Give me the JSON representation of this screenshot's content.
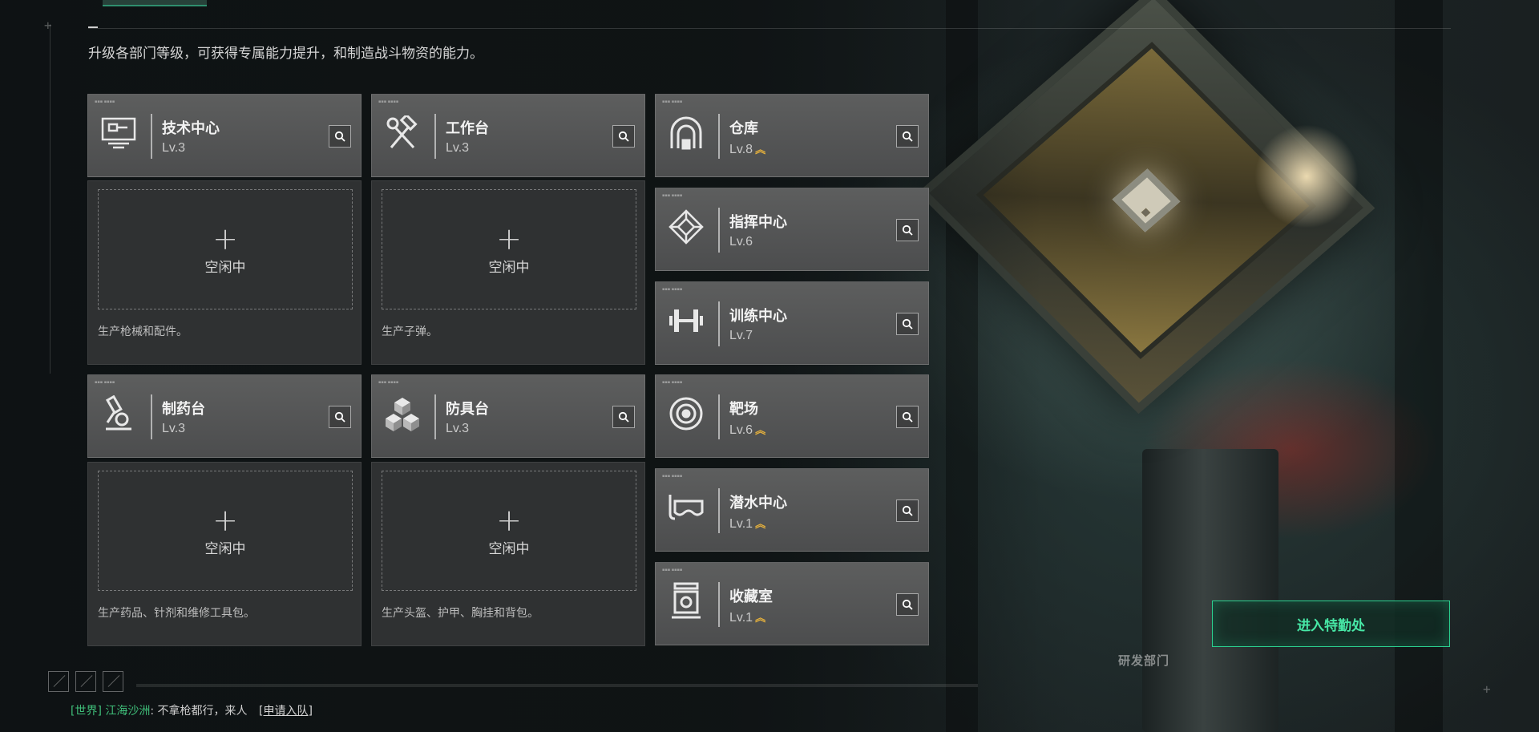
{
  "header": {
    "subtitle": "升级各部门等级，可获得专属能力提升，和制造战斗物资的能力。"
  },
  "production": [
    {
      "name": "技术中心",
      "level": "Lv.3",
      "icon": "computer-terminal-icon",
      "slot_status": "空闲中",
      "slot_plus": "+",
      "description": "生产枪械和配件。"
    },
    {
      "name": "工作台",
      "level": "Lv.3",
      "icon": "hammer-wrench-icon",
      "slot_status": "空闲中",
      "slot_plus": "+",
      "description": "生产子弹。"
    },
    {
      "name": "制药台",
      "level": "Lv.3",
      "icon": "microscope-icon",
      "slot_status": "空闲中",
      "slot_plus": "+",
      "description": "生产药品、针剂和维修工具包。"
    },
    {
      "name": "防具台",
      "level": "Lv.3",
      "icon": "cubes-icon",
      "slot_status": "空闲中",
      "slot_plus": "+",
      "description": "生产头盔、护甲、胸挂和背包。"
    }
  ],
  "facilities": [
    {
      "name": "仓库",
      "level": "Lv.8",
      "upgradable": true,
      "icon": "warehouse-icon"
    },
    {
      "name": "指挥中心",
      "level": "Lv.6",
      "upgradable": false,
      "icon": "chip-icon"
    },
    {
      "name": "训练中心",
      "level": "Lv.7",
      "upgradable": false,
      "icon": "dumbbell-icon"
    },
    {
      "name": "靶场",
      "level": "Lv.6",
      "upgradable": true,
      "icon": "target-icon"
    },
    {
      "name": "潜水中心",
      "level": "Lv.1",
      "upgradable": true,
      "icon": "diving-mask-icon"
    },
    {
      "name": "收藏室",
      "level": "Lv.1",
      "upgradable": true,
      "icon": "display-case-icon"
    }
  ],
  "upgrade_glyph": "︽",
  "enter_button": {
    "label": "进入特勤处"
  },
  "scene_label": "研发部门",
  "chat": {
    "channel": "[世界]",
    "sender": "江海沙洲",
    "message": ": 不拿枪都行，来人",
    "action": "[申请入队]"
  },
  "colors": {
    "accent_green": "#2bd08f",
    "upgrade_gold": "#e6b13c",
    "card_bg": "#58595a",
    "panel_bg": "#2f3132"
  }
}
